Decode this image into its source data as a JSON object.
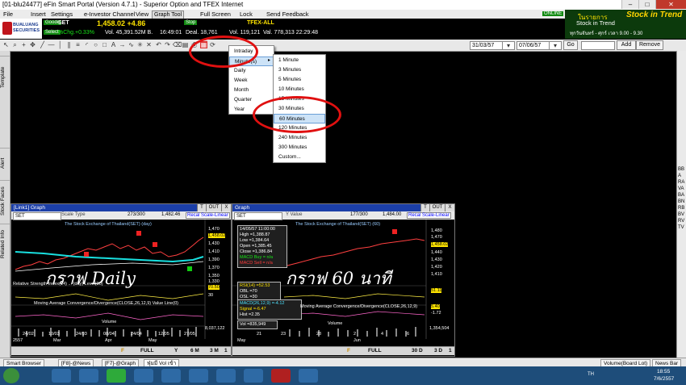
{
  "window": {
    "title": "[01-blu24477] eFin Smart Portal (Version 4.7.1) - Superior Option and TFEX Internet",
    "online": "ONLINE"
  },
  "menu": {
    "items": [
      "File",
      "Insert",
      "Settings",
      "e-Investor Channel",
      "View",
      "Graph Tool",
      "Full Screen",
      "Lock",
      "Send Feedback"
    ]
  },
  "ad": {
    "line1": "ในรายการ",
    "line2": "Stock in Trend",
    "line3": "ทุกวันจันทร์ - ศุกร์ เวลา 9.00 - 9.30",
    "brand": "Stock in Trend"
  },
  "ticker": {
    "logo": "BUALUANG SECURITIES",
    "tag1": "Goode",
    "tag2": "Select",
    "tag3": "Stop",
    "symbol": "SET",
    "price": "1,458.02 +4.86",
    "pct": "%Chg.+0.33%",
    "vol": "Vol. 45,391.52M B.",
    "time": "16:49:01",
    "deal": "Deal. 18,761",
    "vol2": "Vol. 119,121",
    "tfex": "TFEX-ALL",
    "tfexval": "Val. 778,313 22:29:48"
  },
  "toolbar": {
    "date_from": "31/03/57",
    "date_to": "07/06/57",
    "go": "Go",
    "add": "Add",
    "remove": "Remove"
  },
  "left_tabs": [
    "Template",
    "Alert",
    "Stock Faces",
    "Related Info"
  ],
  "right_panel": [
    "BB",
    "A",
    "RA",
    "VA",
    "BA",
    "BN",
    "RB",
    "BV",
    "RV",
    "TV"
  ],
  "menu_period": {
    "items": [
      "Intraday",
      "Minute(s)",
      "Daily",
      "Week",
      "Month",
      "Quarter",
      "Year"
    ]
  },
  "menu_minutes": {
    "items": [
      "1 Minute",
      "3 Minutes",
      "5 Minutes",
      "10 Minutes",
      "15 Minutes",
      "30 Minutes",
      "60 Minutes",
      "120 Minutes",
      "240 Minutes",
      "300 Minutes",
      "Custom..."
    ]
  },
  "panel1": {
    "title": "[Link1] Graph",
    "t": "T",
    "out": "OUT",
    "x": "X",
    "symbol": "SET",
    "scale_label": "Scale Type",
    "count": "273/300",
    "value": "1,482.46",
    "recal": "Recal Scale-Linear",
    "subtitle": "The Stock Exchange of Thailand(SET) (day)",
    "yticks": [
      "1,470",
      "1,458.02",
      "1,430",
      "1,410",
      "1,390",
      "1,370",
      "1,350",
      "1,330"
    ],
    "big": "กราฟ Daily",
    "rsi_label": "Relative Strength Index(14) ... (day) Level(30)",
    "rsi_vals": [
      "70.50",
      "30"
    ],
    "macd_label": "Moving Average Convergence/Divergence(CLOSE,26,12,9) Value Line(0)",
    "volume_label": "Volume",
    "vol_value": "8,037,122",
    "xticks": [
      "24/02",
      "10/03",
      "24/03",
      "08/04",
      "24/04",
      "12/05",
      "27/05"
    ],
    "xyear": [
      "2557",
      "Mar",
      "Apr",
      "May"
    ],
    "nav": [
      "F",
      "FULL",
      "Y",
      "6 M",
      "3 M",
      "1"
    ]
  },
  "panel2": {
    "title": "Graph",
    "t": "T",
    "out": "OUT",
    "x": "X",
    "symbol": "SET",
    "value_label": "Y Value",
    "count": "177/300",
    "value": "1,484.00",
    "recal": "Recal Scale-Linear",
    "subtitle": "The Stock Exchange of Thailand(SET) (60)",
    "yticks": [
      "1,480",
      "1,470",
      "1,458.02",
      "1,440",
      "1,430",
      "1,420",
      "1,410"
    ],
    "big": "กราฟ 60 นาที",
    "info": [
      "14/05/57 11:00:00",
      "High =1,388.87",
      "Low =1,384.64",
      "Open =1,385.45",
      "Close =1,386.84",
      "MACD Buy = n/a",
      "MACD Sell = n/a"
    ],
    "rsi_info": [
      "RSI(14) =52.53",
      "OBL =70",
      "OSL =30"
    ],
    "rsi_val": "51.11",
    "macd_info": [
      "MACD(26,12,9) =-4.12",
      "Signal =-6.47",
      "Hist =2.35"
    ],
    "macd_vals": [
      "5.40",
      "-1.72"
    ],
    "macd_label": "Moving Average Convergence/Divergence(CLOSE,26,12,9)",
    "volume_label": "Volume",
    "vol_info": "Vol =835,949",
    "vol_value": "1,354,504",
    "xticks": [
      "21",
      "23",
      "28",
      "2",
      "4",
      "6"
    ],
    "xyear": [
      "May",
      "Jun"
    ],
    "nav": [
      "F",
      "FULL",
      "30 D",
      "3 D",
      "1"
    ]
  },
  "status": {
    "tabs": [
      "Smart Browser",
      "[F8]-@News",
      "[F7]-@Graph",
      "ฟุ่มมี Vol เข้า"
    ],
    "right": "Volume(Board Lot)",
    "news": "News Bar"
  },
  "taskbar": {
    "clock": "18:55",
    "date": "7/6/2557",
    "lang": "TH"
  },
  "colors": {
    "accent_red": "#e01010",
    "header_blue": "#1c3fa8",
    "up_green": "#17e617",
    "price_yellow": "#ffe400"
  }
}
